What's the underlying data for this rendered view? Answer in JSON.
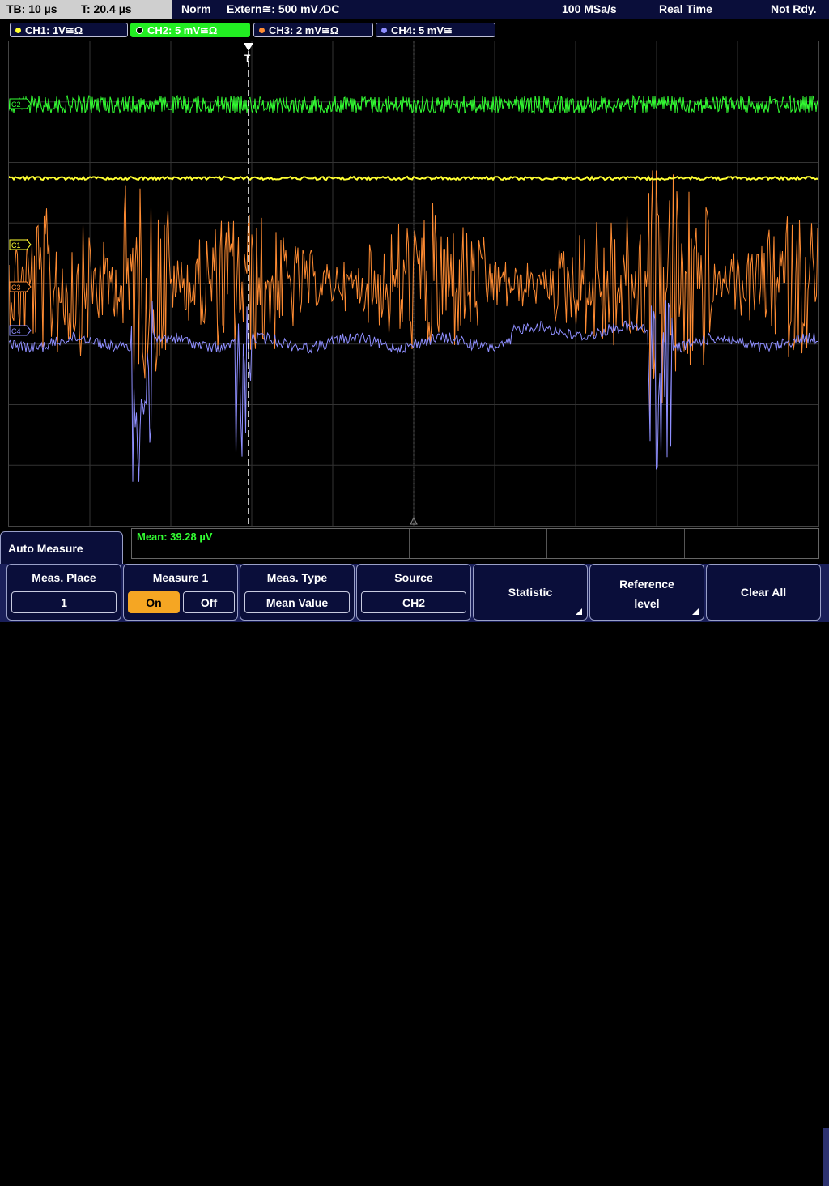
{
  "topbar": {
    "timebase": "TB: 10 µs",
    "trigger_time": "T: 20.4 µs",
    "trigger_mode": "Norm",
    "trigger_source": "Extern≅: 500 mV ⁄DC",
    "sample_rate": "100 MSa/s",
    "acq_mode": "Real Time",
    "status": "Not Rdy."
  },
  "channels": [
    {
      "label": "CH1: 1V≅Ω",
      "color": "#ffff33"
    },
    {
      "label": "CH2: 5 mV≅Ω",
      "color": "#33ff33",
      "active": true
    },
    {
      "label": "CH3: 2 mV≅Ω",
      "color": "#ff8c33"
    },
    {
      "label": "CH4: 5 mV≅",
      "color": "#8f8fff"
    }
  ],
  "markers": {
    "ch1": "C1",
    "ch2": "C2",
    "ch3": "C3",
    "ch4": "C4",
    "trigger": "T"
  },
  "measurement": {
    "readout": "Mean: 39.28 µV"
  },
  "menu": {
    "title": "Auto Measure",
    "softkeys": {
      "meas_place_label": "Meas. Place",
      "meas_place_value": "1",
      "measure1_label": "Measure 1",
      "on_label": "On",
      "off_label": "Off",
      "meas_type_label": "Meas. Type",
      "meas_type_value": "Mean Value",
      "source_label": "Source",
      "source_value": "CH2",
      "statistic_label": "Statistic",
      "reference_label_1": "Reference",
      "reference_label_2": "level",
      "clear_all_label": "Clear All"
    }
  },
  "colors": {
    "ch1": "#ffff33",
    "ch2": "#33ff33",
    "ch3": "#ff8c33",
    "ch4": "#8f8fff",
    "active_on": "#f5a623"
  }
}
